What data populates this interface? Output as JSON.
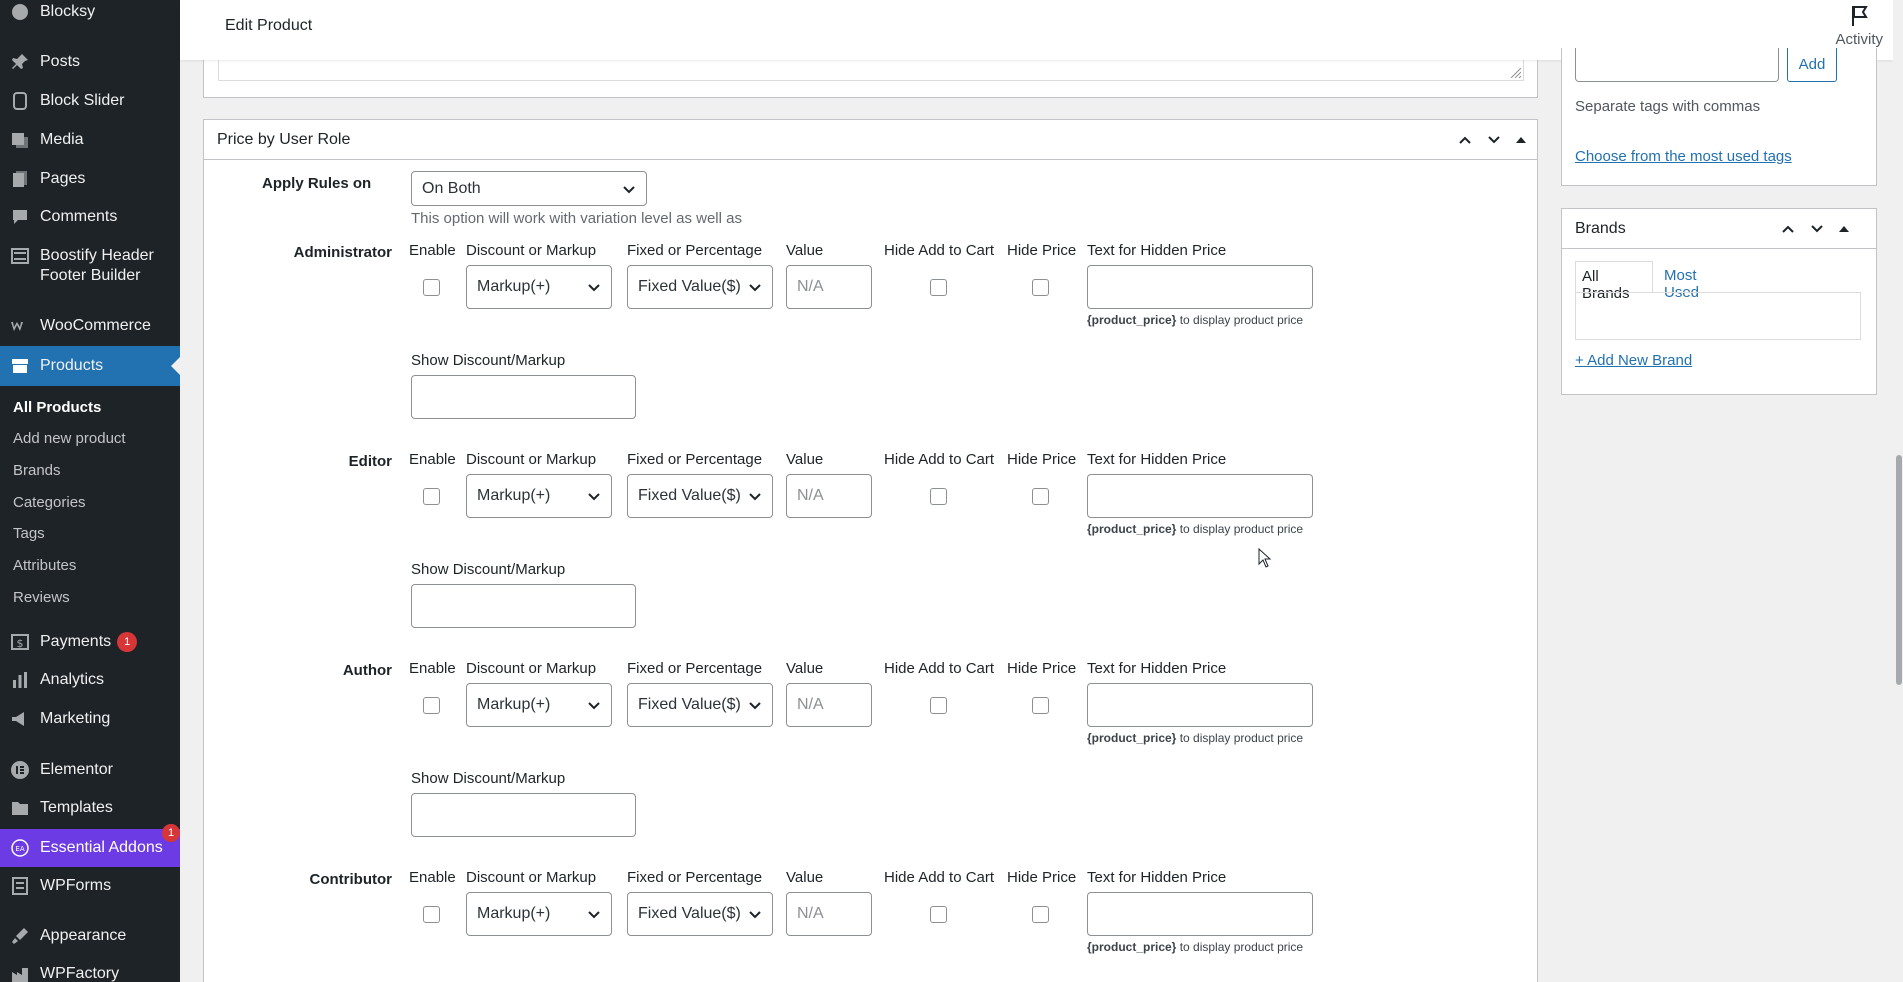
{
  "sidebar": {
    "items": [
      {
        "label": "Blocksy",
        "icon": "blocksy-icon"
      },
      {
        "label": "Posts",
        "icon": "pin-icon"
      },
      {
        "label": "Block Slider",
        "icon": "slider-icon"
      },
      {
        "label": "Media",
        "icon": "media-icon"
      },
      {
        "label": "Pages",
        "icon": "pages-icon"
      },
      {
        "label": "Comments",
        "icon": "comments-icon"
      },
      {
        "label": "Boostify Header Footer Builder",
        "icon": "builder-icon"
      },
      {
        "label": "WooCommerce",
        "icon": "woocommerce-icon"
      },
      {
        "label": "Products",
        "icon": "products-icon"
      },
      {
        "label": "Payments",
        "icon": "payments-icon",
        "badge": "1"
      },
      {
        "label": "Analytics",
        "icon": "analytics-icon"
      },
      {
        "label": "Marketing",
        "icon": "marketing-icon"
      },
      {
        "label": "Elementor",
        "icon": "elementor-icon"
      },
      {
        "label": "Templates",
        "icon": "templates-icon"
      },
      {
        "label": "Essential Addons",
        "icon": "essential-addons-icon",
        "badge": "1"
      },
      {
        "label": "WPForms",
        "icon": "wpforms-icon"
      },
      {
        "label": "Appearance",
        "icon": "appearance-icon"
      },
      {
        "label": "WPFactory",
        "icon": "wpfactory-icon"
      }
    ],
    "submenu": [
      "All Products",
      "Add new product",
      "Brands",
      "Categories",
      "Tags",
      "Attributes",
      "Reviews"
    ],
    "accent": "#2271b1",
    "ea_color": "#6c3be4"
  },
  "header": {
    "title": "Edit Product",
    "activity_label": "Activity"
  },
  "price_box": {
    "title": "Price by User Role",
    "apply_label": "Apply Rules on",
    "apply_value": "On Both",
    "apply_note": "This option will work with variation level as well as",
    "columns": {
      "enable": "Enable",
      "discount": "Discount or Markup",
      "fixed": "Fixed or Percentage",
      "value": "Value",
      "hide_cart": "Hide Add to Cart",
      "hide_price": "Hide Price",
      "hidden_text": "Text for Hidden Price"
    },
    "discount_value": "Markup(+)",
    "fixed_value": "Fixed Value($)",
    "value_placeholder": "N/A",
    "hint_token": "{product_price}",
    "hint_text": " to display product price",
    "show_label": "Show Discount/Markup",
    "roles": [
      "Administrator",
      "Editor",
      "Author",
      "Contributor"
    ]
  },
  "tags_box": {
    "add_label": "Add",
    "separate_note": "Separate tags with commas",
    "most_used_link": "Choose from the most used tags"
  },
  "brands_box": {
    "title": "Brands",
    "tab_all": "All Brands",
    "tab_most": "Most Used",
    "add_link": "+ Add New Brand"
  }
}
